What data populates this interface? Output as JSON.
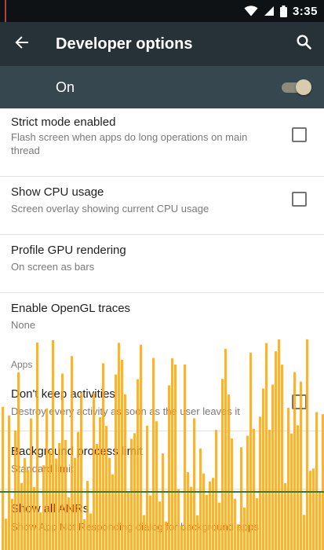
{
  "status_bar": {
    "time": "3:35",
    "icons": [
      "wifi-icon",
      "signal-icon",
      "battery-icon"
    ]
  },
  "app_bar": {
    "title": "Developer options",
    "back_icon": "arrow-back-icon",
    "search_icon": "search-icon"
  },
  "master_switch": {
    "label": "On",
    "checked": true
  },
  "preferences": [
    {
      "title": "Strict mode enabled",
      "summary": "Flash screen when apps do long operations on main thread",
      "control": "checkbox",
      "checked": false
    },
    {
      "title": "Show CPU usage",
      "summary": "Screen overlay showing current CPU usage",
      "control": "checkbox",
      "checked": false
    },
    {
      "title": "Profile GPU rendering",
      "summary": "On screen as bars"
    },
    {
      "title": "Enable OpenGL traces",
      "summary": "None"
    }
  ],
  "category": "Apps",
  "app_preferences": [
    {
      "title": "Don't keep activities",
      "summary": "Destroy every activity as soon as the user leaves it",
      "control": "checkbox",
      "checked": false
    },
    {
      "title": "Background process limit",
      "summary": "Standard limit"
    },
    {
      "title": "Show all ANRs",
      "summary": "Show App Not Responding dialog for background apps"
    }
  ],
  "colors": {
    "status_bar": "#0e1214",
    "app_bar": "#263238",
    "master_row": "#37474f",
    "gpu_bar": "#f5a623",
    "gpu_threshold": "#2e7d32",
    "switch_thumb": "#d9ccae"
  }
}
